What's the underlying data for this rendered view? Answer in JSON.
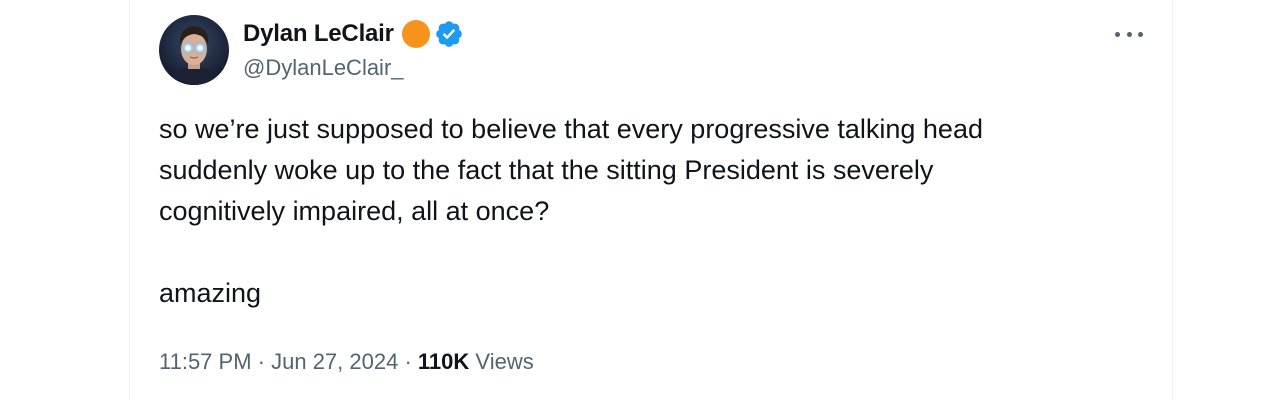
{
  "author": {
    "display_name": "Dylan LeClair",
    "handle": "@DylanLeClair_",
    "badge_color": "#f7931a",
    "verified_color": "#1d9bf0",
    "avatar_icon": "avatar-with-glowing-eyes"
  },
  "more_menu_icon": "more-horizontal-icon",
  "tweet": {
    "text_paragraph_1": "so we’re just supposed to believe that every progressive talking head\nsuddenly woke up to the fact that the sitting President is severely\ncognitively impaired, all at once?",
    "text_paragraph_2": "amazing"
  },
  "meta": {
    "time": "11:57 PM",
    "separator": " · ",
    "date": "Jun 27, 2024",
    "views_count": "110K",
    "views_label": "Views"
  },
  "colors": {
    "text_primary": "#0f1419",
    "text_secondary": "#536471",
    "border": "#eff3f4"
  }
}
